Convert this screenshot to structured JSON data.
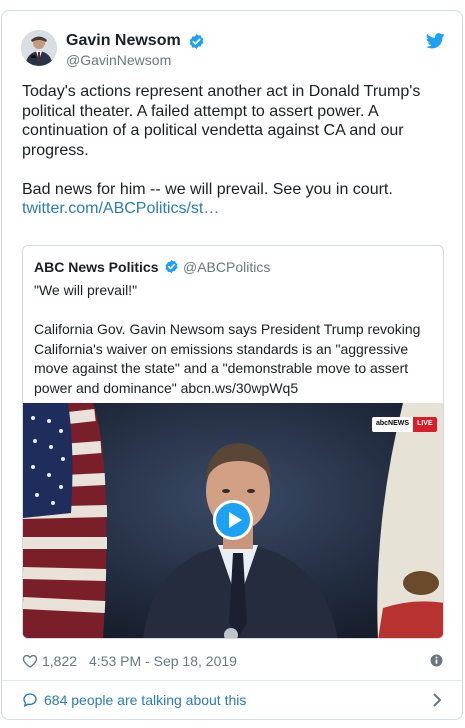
{
  "author": {
    "name": "Gavin Newsom",
    "handle": "@GavinNewsom"
  },
  "tweet": {
    "paragraph1": "Today's actions represent another act in Donald Trump's political theater. A failed attempt to assert power. A continuation of a political vendetta against CA and our progress.",
    "paragraph2": "Bad news for him -- we will prevail. See you in court.",
    "link": "twitter.com/ABCPolitics/st…"
  },
  "quoted": {
    "name": "ABC News Politics",
    "handle": "@ABCPolitics",
    "line1": "\"We will prevail!\"",
    "line2": "California Gov. Gavin Newsom says President Trump revoking California's waiver on emissions standards is an \"aggressive move against the state\" and a \"demonstrable move to assert power and dominance\" abcn.ws/30wpWq5",
    "badge_network": "abcNEWS",
    "badge_live": "LIVE"
  },
  "footer": {
    "likes": "1,822",
    "timestamp": "4:53 PM - Sep 18, 2019",
    "talking": "684 people are talking about this"
  },
  "icons": {
    "verified": "verified-badge-icon",
    "logo": "twitter-bird-icon",
    "like": "heart-icon",
    "info": "info-icon",
    "reply": "comment-icon",
    "more": "chevron-right-icon",
    "play": "play-icon"
  },
  "colors": {
    "twitter_blue": "#1da1f2",
    "link_blue": "#2b7bb9",
    "secondary_text": "#697882",
    "primary_text": "#1c2022",
    "border": "#d4dbe1",
    "live_red": "#d81e2c"
  }
}
